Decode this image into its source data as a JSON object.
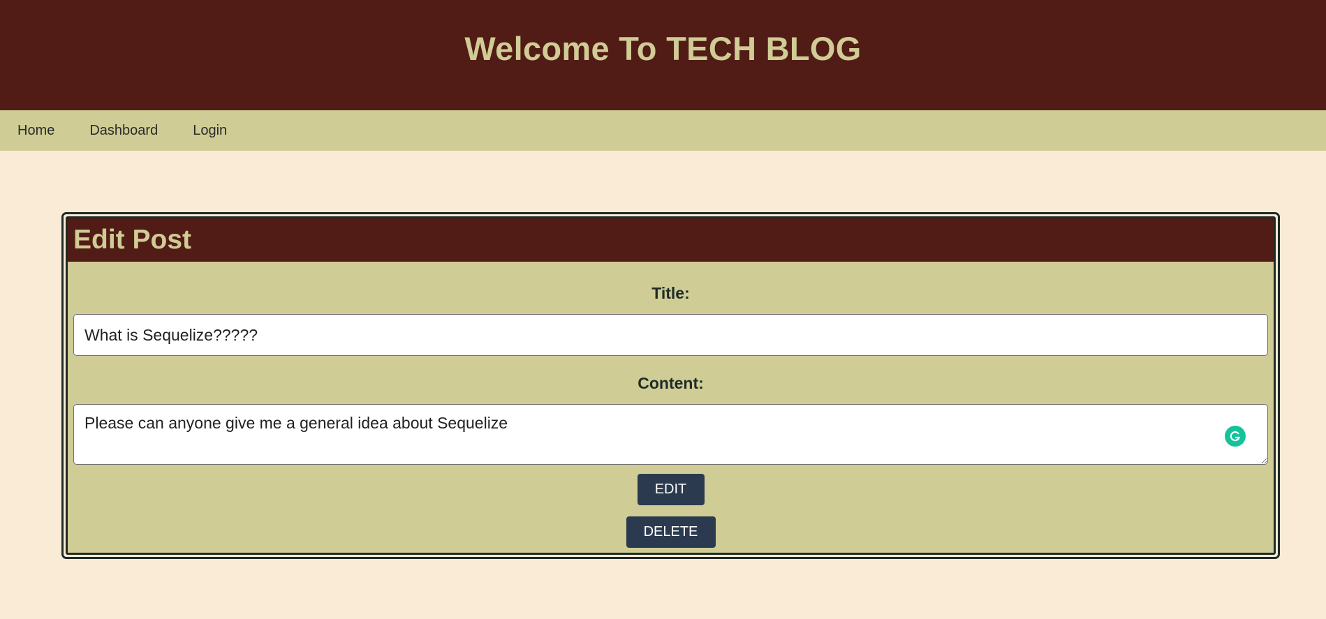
{
  "header": {
    "title": "Welcome To TECH BLOG"
  },
  "nav": {
    "items": [
      {
        "label": "Home"
      },
      {
        "label": "Dashboard"
      },
      {
        "label": "Login"
      }
    ]
  },
  "edit_post": {
    "heading": "Edit Post",
    "title_label": "Title:",
    "title_value": "What is Sequelize?????",
    "content_label": "Content:",
    "content_value": "Please can anyone give me a general idea about Sequelize",
    "edit_button": "EDIT",
    "delete_button": "DELETE"
  },
  "colors": {
    "header_bg": "#511c15",
    "accent_text": "#d1cb95",
    "nav_bg": "#cfcd95",
    "page_bg": "#faebd7",
    "button_bg": "#2b3a4e",
    "grammarly": "#15c39a"
  },
  "icons": {
    "grammarly": "grammarly-icon"
  }
}
